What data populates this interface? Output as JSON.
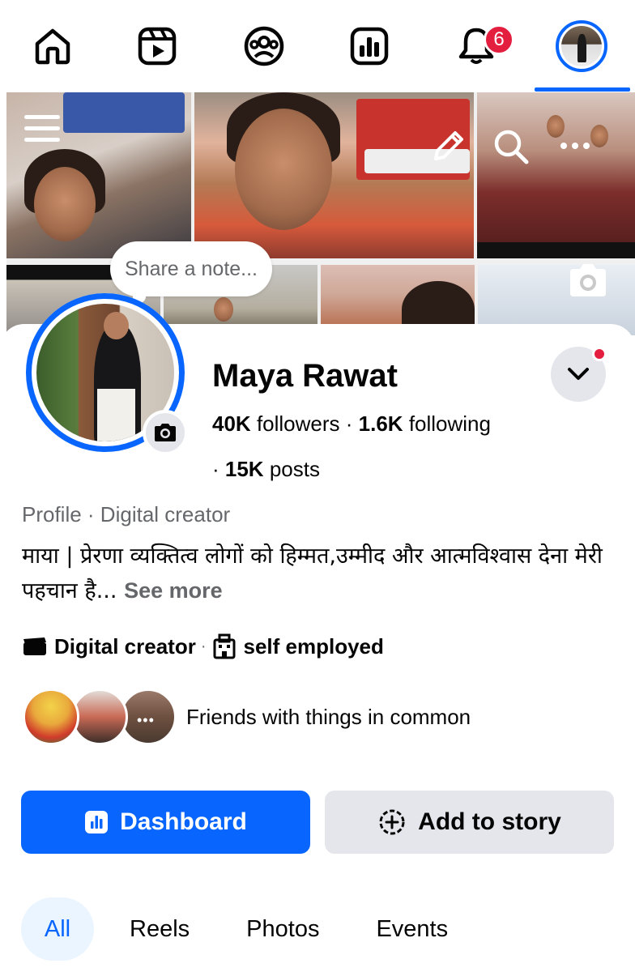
{
  "nav": {
    "items": [
      {
        "name": "home-icon"
      },
      {
        "name": "reels-icon"
      },
      {
        "name": "groups-icon"
      },
      {
        "name": "dashboard-icon"
      },
      {
        "name": "bell-icon",
        "badge": "6"
      },
      {
        "name": "profile-avatar",
        "active": true
      }
    ],
    "accent": "#0866ff",
    "badge_color": "#e41e3f"
  },
  "cover": {
    "share_note_placeholder": "Share a note..."
  },
  "profile": {
    "name": "Maya Rawat",
    "followers_count": "40K",
    "followers_label": "followers",
    "following_count": "1.6K",
    "following_label": "following",
    "posts_count": "15K",
    "posts_label": "posts",
    "type": "Profile · Digital creator",
    "bio": "माया | प्रेरणा व्यक्तित्व लोगों को हिम्मत,उम्मीद और आत्मविश्वास देना मेरी पहचान है...",
    "see_more": "See more",
    "detail_category": "Digital creator",
    "detail_work": "self employed",
    "friends_text": "Friends with things in common"
  },
  "actions": {
    "dashboard_label": "Dashboard",
    "add_story_label": "Add to story"
  },
  "tabs": [
    {
      "label": "All",
      "active": true
    },
    {
      "label": "Reels"
    },
    {
      "label": "Photos"
    },
    {
      "label": "Events"
    }
  ]
}
